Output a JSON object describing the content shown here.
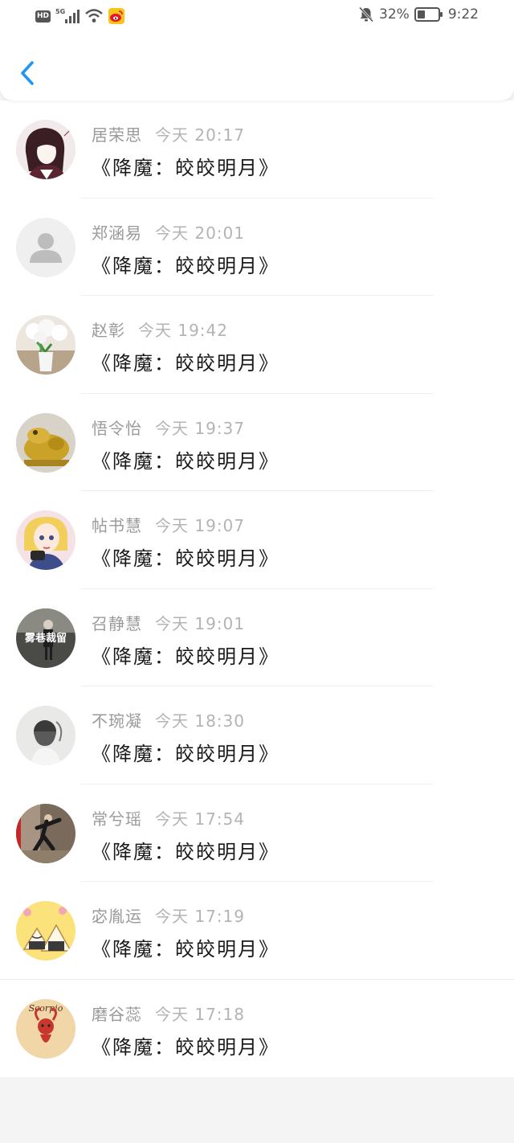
{
  "status_bar": {
    "hd": "HD",
    "network": "5G",
    "battery": "32%",
    "time": "9:22",
    "icons": [
      "hd-icon",
      "signal-icon",
      "wifi-icon",
      "weibo-icon",
      "mute-bell-icon",
      "battery-icon"
    ]
  },
  "header": {
    "back_icon": "chevron-left-icon",
    "accent": "#2196f3"
  },
  "comments": [
    {
      "name": "居荣思",
      "time": "今天 20:17",
      "message": "《降魔：皎皎明月》",
      "avatar": "anime-girl-avatar"
    },
    {
      "name": "郑涵易",
      "time": "今天 20:01",
      "message": "《降魔：皎皎明月》",
      "avatar": "default-user-avatar"
    },
    {
      "name": "赵彰",
      "time": "今天 19:42",
      "message": "《降魔：皎皎明月》",
      "avatar": "flower-vase-avatar"
    },
    {
      "name": "悟令怡",
      "time": "今天 19:37",
      "message": "《降魔：皎皎明月》",
      "avatar": "golden-frog-avatar"
    },
    {
      "name": "帖书慧",
      "time": "今天 19:07",
      "message": "《降魔：皎皎明月》",
      "avatar": "sailor-moon-avatar"
    },
    {
      "name": "召静慧",
      "time": "今天 19:01",
      "message": "《降魔：皎皎明月》",
      "avatar": "street-photo-avatar",
      "avatar_text": "雾巷裁留"
    },
    {
      "name": "不琬凝",
      "time": "今天 18:30",
      "message": "《降魔：皎皎明月》",
      "avatar": "girl-sketch-avatar"
    },
    {
      "name": "常兮瑶",
      "time": "今天 17:54",
      "message": "《降魔：皎皎明月》",
      "avatar": "dancer-avatar"
    },
    {
      "name": "宓胤运",
      "time": "今天 17:19",
      "message": "《降魔：皎皎明月》",
      "avatar": "rice-ball-avatar"
    },
    {
      "name": "磨谷蕊",
      "time": "今天 17:18",
      "message": "《降魔：皎皎明月》",
      "avatar": "scorpio-avatar",
      "avatar_text": "Scorpio"
    }
  ]
}
